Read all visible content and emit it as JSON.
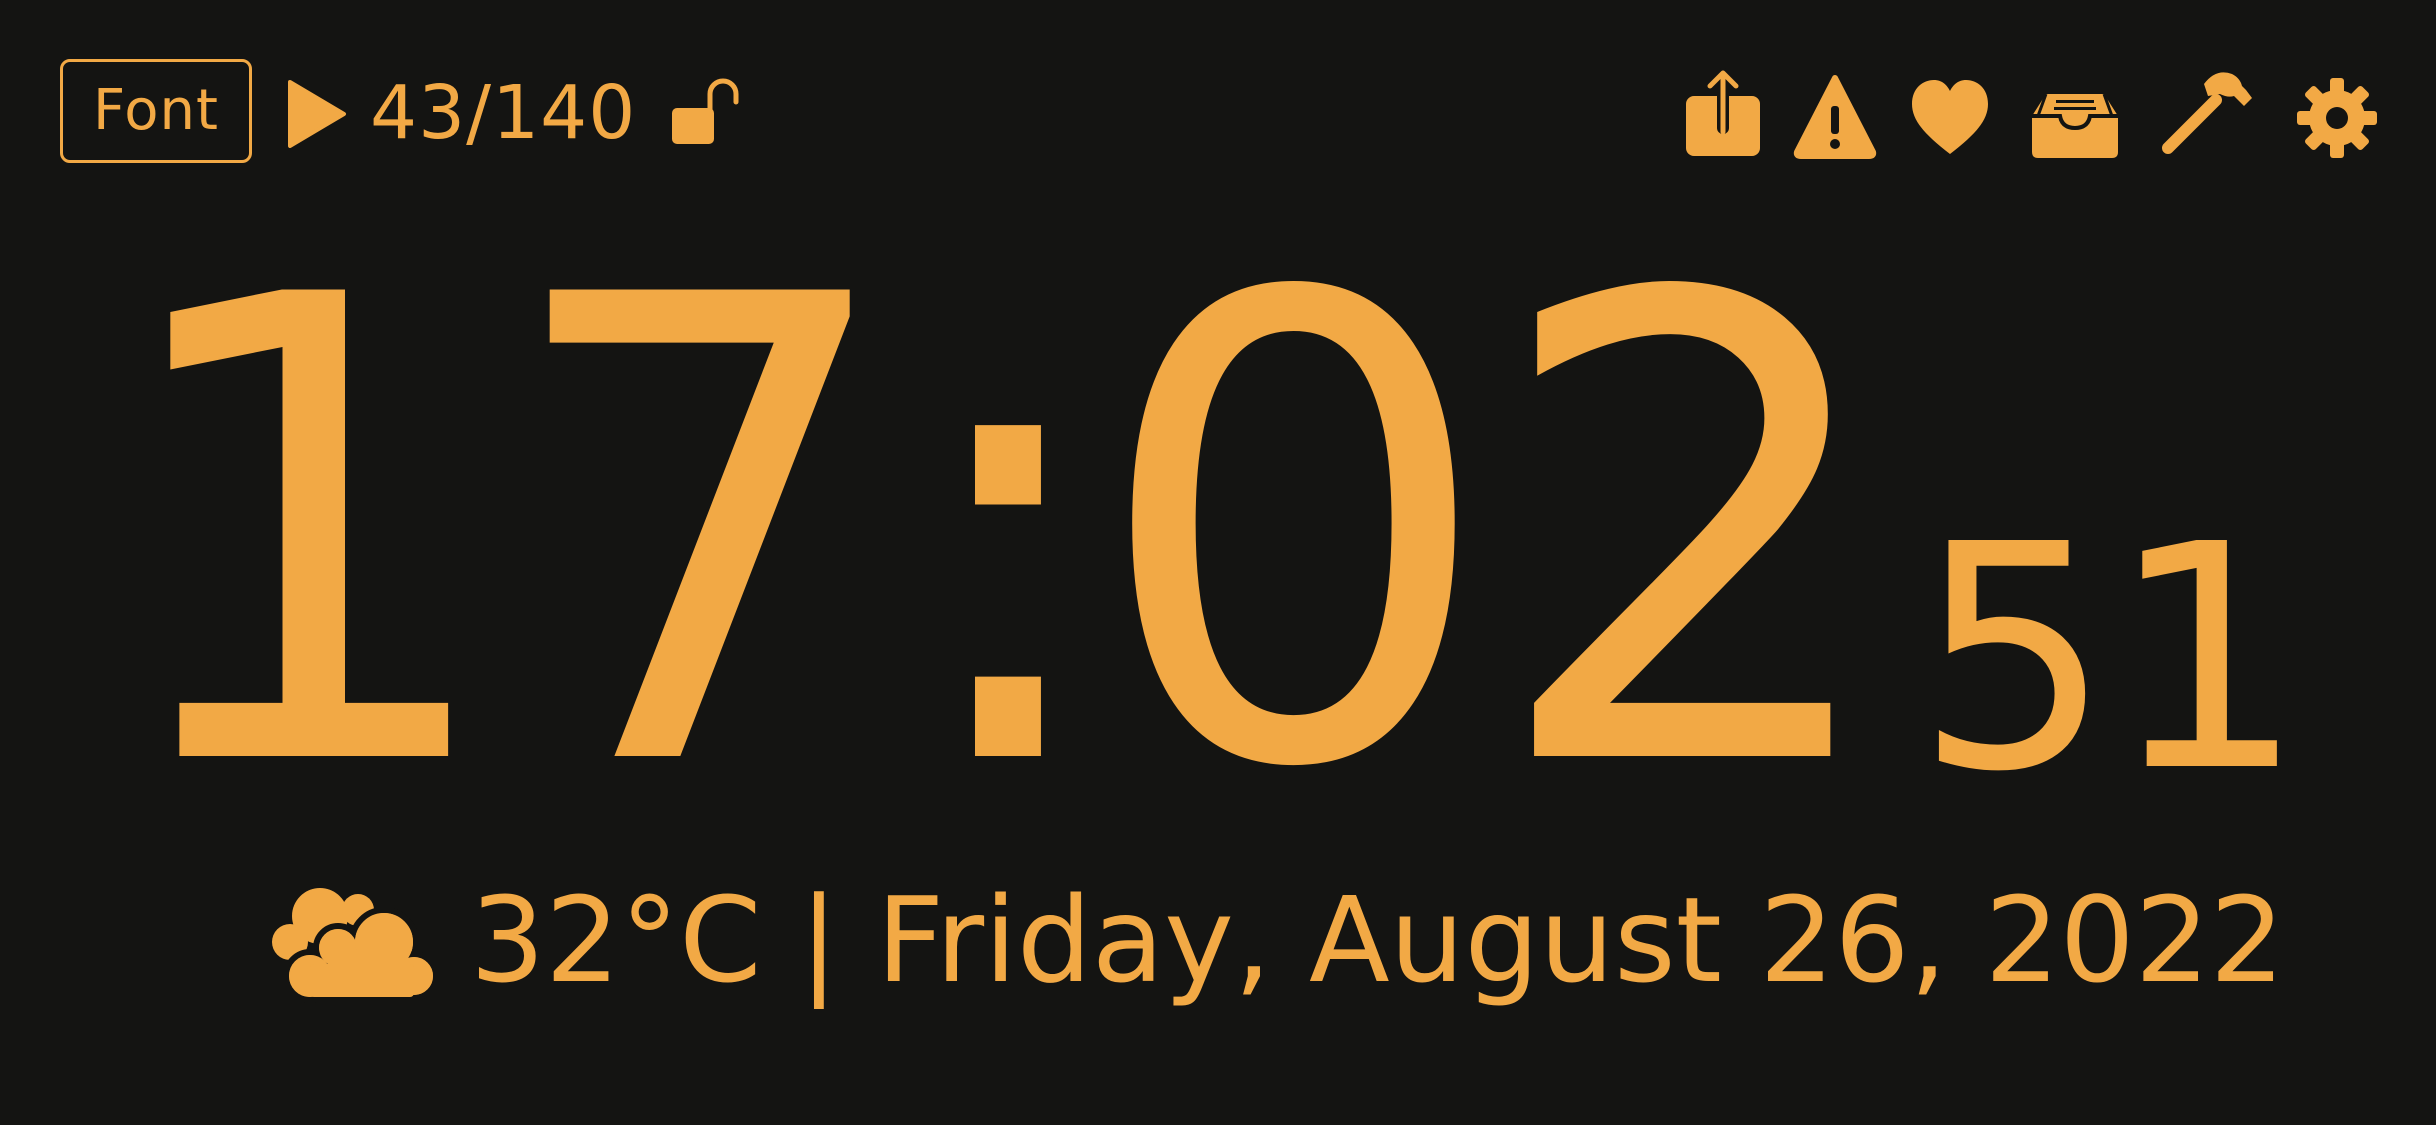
{
  "toolbar_left": {
    "font_button_label": "Font",
    "play_icon": "play-icon",
    "track_counter": "43/140",
    "lock_icon": "unlocked-padlock-icon"
  },
  "toolbar_right": {
    "icons": [
      "share-icon",
      "warning-icon",
      "heart-icon",
      "inbox-tray-icon",
      "hammer-icon",
      "gear-icon"
    ]
  },
  "clock": {
    "hours": "17",
    "separator": ":",
    "minutes": "02",
    "seconds": "51"
  },
  "weather": {
    "icon": "cloudy-icon",
    "temperature": "32°C",
    "separator": "|",
    "date": "Friday, August 26, 2022",
    "line": "32°C | Friday, August 26, 2022"
  },
  "colors": {
    "background": "#141412",
    "accent": "#F2A945"
  }
}
